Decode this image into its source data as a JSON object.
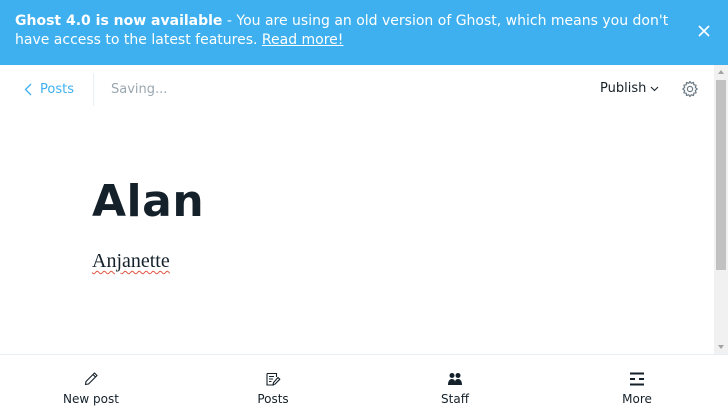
{
  "banner": {
    "bold": "Ghost 4.0 is now available",
    "message": " - You are using an old version of Ghost, which means you don't have access to the latest features. ",
    "link": "Read more!"
  },
  "header": {
    "back_label": "Posts",
    "status": "Saving...",
    "publish_label": "Publish"
  },
  "post": {
    "title": "Alan",
    "body": "Anjanette"
  },
  "bottom_nav": {
    "items": [
      {
        "label": "New post",
        "icon": "pencil-icon"
      },
      {
        "label": "Posts",
        "icon": "posts-icon"
      },
      {
        "label": "Staff",
        "icon": "staff-icon"
      },
      {
        "label": "More",
        "icon": "more-icon"
      }
    ]
  },
  "colors": {
    "accent": "#3eb0ef",
    "text": "#15212a",
    "muted": "#9aa7b0"
  }
}
